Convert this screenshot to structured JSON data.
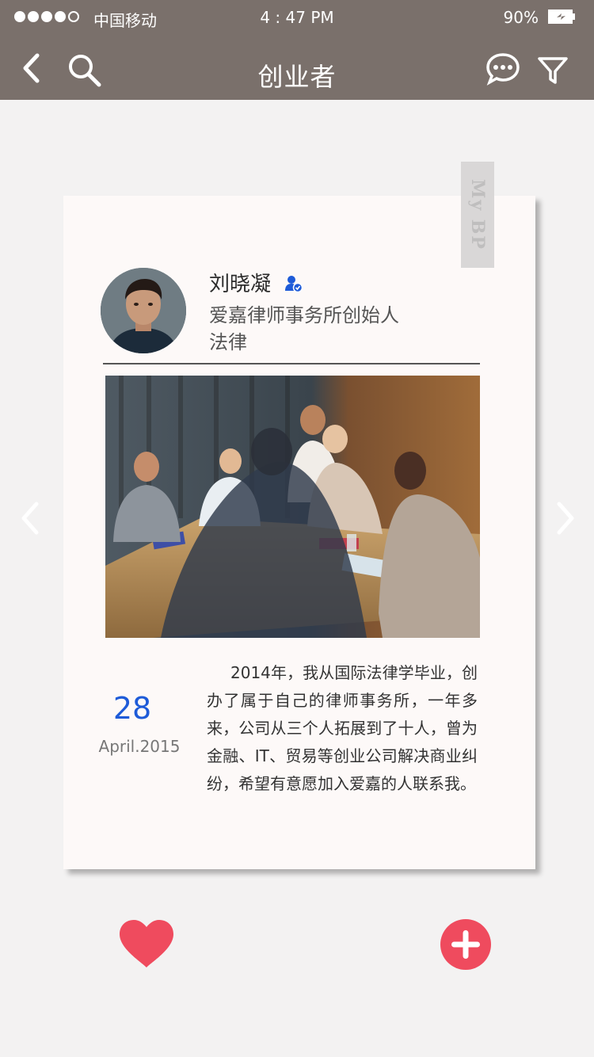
{
  "status_bar": {
    "carrier": "中国移动",
    "time": "4 : 47 PM",
    "battery": "90%"
  },
  "nav": {
    "title": "创业者",
    "back_icon": "chevron-left-icon",
    "search_icon": "search-icon",
    "chat_icon": "chat-bubble-icon",
    "filter_icon": "funnel-filter-icon"
  },
  "card": {
    "ribbon_text": "My BP",
    "profile": {
      "name": "刘晓凝",
      "title": "爱嘉律师事务所创始人",
      "field": "法律"
    },
    "date": {
      "day": "28",
      "month_year": "April.2015"
    },
    "description": "2014年，我从国际法律学毕业，创办了属于自己的律师事务所，一年多来，公司从三个人拓展到了十人，曾为金融、IT、贸易等创业公司解决商业纠纷，希望有意愿加入爱嘉的人联系我。"
  },
  "colors": {
    "header_bg": "#7a706b",
    "accent_blue": "#1e5bd8",
    "heart_red": "#ef4b5e",
    "add_red": "#ef4b5e"
  }
}
